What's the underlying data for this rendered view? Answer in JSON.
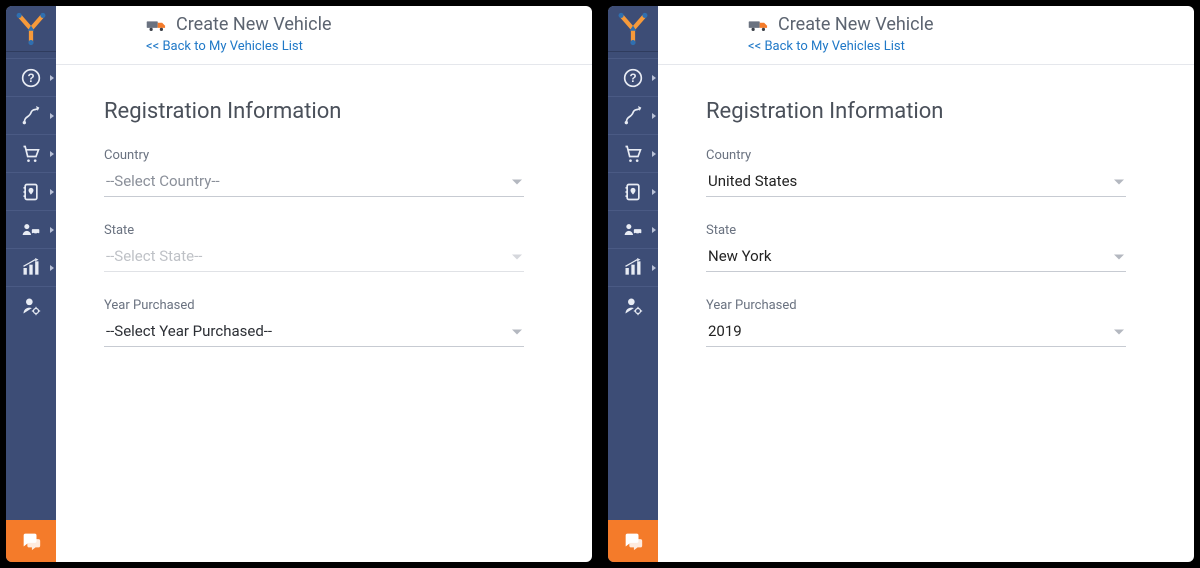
{
  "header": {
    "title": "Create New Vehicle",
    "back_link": "<< Back to My Vehicles List"
  },
  "sidebar": {
    "items": [
      {
        "name": "help-icon",
        "has_arrow": true
      },
      {
        "name": "routes-icon",
        "has_arrow": true
      },
      {
        "name": "cart-icon",
        "has_arrow": true
      },
      {
        "name": "address-book-icon",
        "has_arrow": true
      },
      {
        "name": "users-vehicle-icon",
        "has_arrow": true
      },
      {
        "name": "analytics-icon",
        "has_arrow": true
      },
      {
        "name": "user-settings-icon",
        "has_arrow": false
      }
    ],
    "chat_icon": "chat-icon"
  },
  "colors": {
    "sidebar_bg": "#3d4d76",
    "accent_orange": "#f47b2a",
    "link_blue": "#1f78c7"
  },
  "left": {
    "section_title": "Registration Information",
    "fields": {
      "country": {
        "label": "Country",
        "value": "--Select Country--",
        "is_placeholder": true,
        "strong": false,
        "disabled": false
      },
      "state": {
        "label": "State",
        "value": "--Select State--",
        "is_placeholder": true,
        "strong": false,
        "disabled": true
      },
      "year": {
        "label": "Year Purchased",
        "value": "--Select Year Purchased--",
        "is_placeholder": true,
        "strong": true,
        "disabled": false
      }
    }
  },
  "right": {
    "section_title": "Registration Information",
    "fields": {
      "country": {
        "label": "Country",
        "value": "United States",
        "is_placeholder": false,
        "disabled": false
      },
      "state": {
        "label": "State",
        "value": "New York",
        "is_placeholder": false,
        "disabled": false
      },
      "year": {
        "label": "Year Purchased",
        "value": "2019",
        "is_placeholder": false,
        "disabled": false
      }
    }
  }
}
